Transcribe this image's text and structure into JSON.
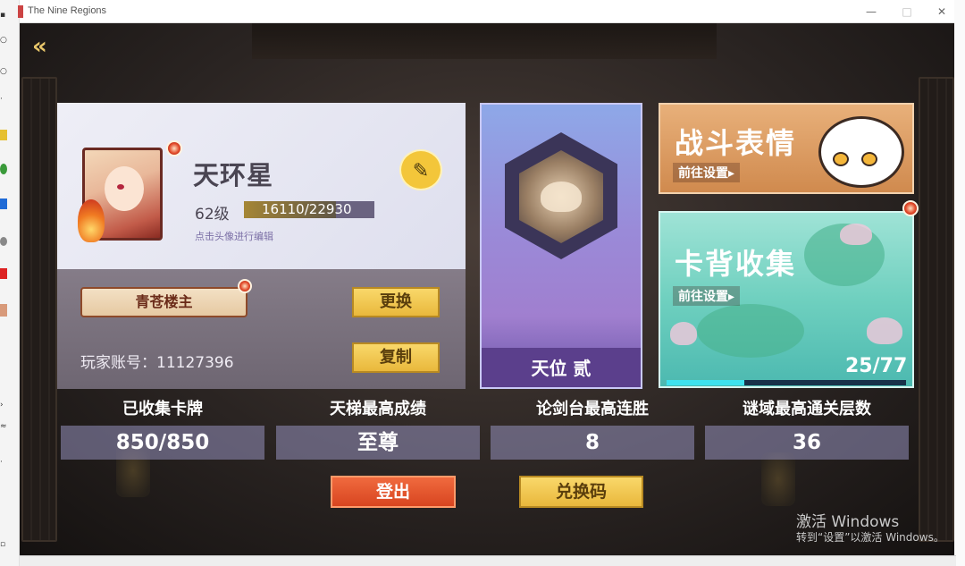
{
  "window": {
    "title": "The Nine Regions",
    "minimize": "—",
    "maximize": "□",
    "close": "✕"
  },
  "nav": {
    "back_icon": "back-arrow-icon",
    "back_glyph": "«"
  },
  "profile": {
    "name": "天环星",
    "level": "62级",
    "xp_text": "16110/22930",
    "xp_fraction": 0.7026,
    "edit_hint": "点击头像进行编辑",
    "edit_glyph": "✎",
    "title_badge": "青苍楼主",
    "change_label": "更换",
    "account_label": "玩家账号：11127396",
    "copy_label": "复制"
  },
  "rank": {
    "label": "天位 贰"
  },
  "emotes": {
    "title": "战斗表情",
    "goto_label": "前往设置▸"
  },
  "card_back": {
    "title": "卡背收集",
    "goto_label": "前往设置▸",
    "progress_text": "25/77",
    "progress_fraction": 0.3247
  },
  "stats": [
    {
      "label": "已收集卡牌",
      "value": "850/850"
    },
    {
      "label": "天梯最高成绩",
      "value": "至尊"
    },
    {
      "label": "论剑台最高连胜",
      "value": "8"
    },
    {
      "label": "谜域最高通关层数",
      "value": "36"
    }
  ],
  "actions": {
    "logout_label": "登出",
    "redeem_label": "兑换码"
  },
  "watermark": {
    "line1": "激活 Windows",
    "line2": "转到“设置”以激活 Windows。"
  },
  "colors": {
    "accent_gold": "#f3c63a",
    "logout_red": "#e4532a",
    "progress_cyan": "#3ee2ee"
  }
}
